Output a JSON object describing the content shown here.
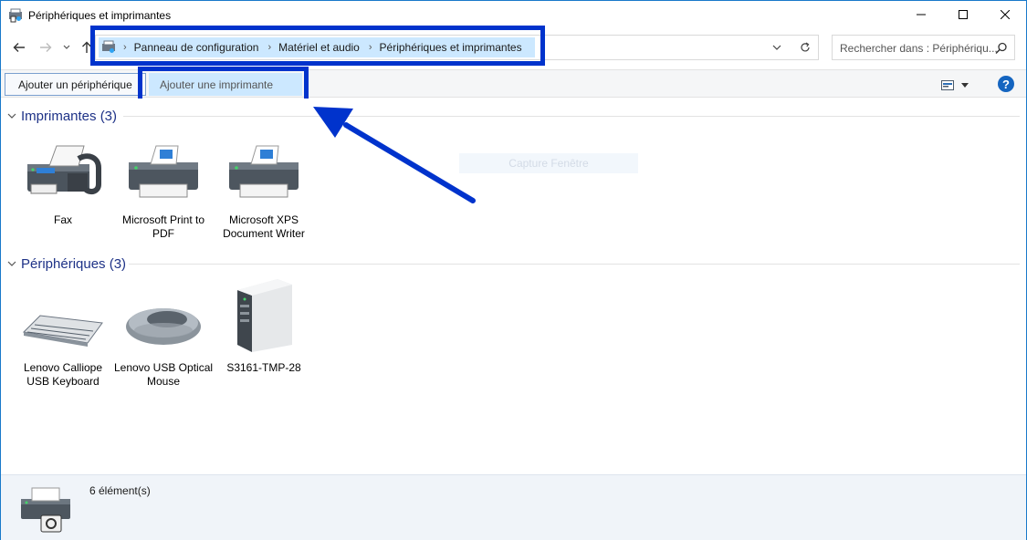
{
  "window": {
    "title": "Périphériques et imprimantes"
  },
  "breadcrumb": {
    "items": [
      "Panneau de configuration",
      "Matériel et audio",
      "Périphériques et imprimantes"
    ]
  },
  "search": {
    "placeholder": "Rechercher dans : Périphériqu..."
  },
  "toolbar": {
    "add_device_label": "Ajouter un périphérique",
    "add_printer_label": "Ajouter une imprimante",
    "help_label": "?"
  },
  "groups": {
    "printers": {
      "title": "Imprimantes (3)",
      "items": [
        {
          "label": "Fax",
          "icon": "fax-icon"
        },
        {
          "label": "Microsoft Print to PDF",
          "icon": "printer-icon"
        },
        {
          "label": "Microsoft XPS Document Writer",
          "icon": "printer-icon"
        }
      ]
    },
    "devices": {
      "title": "Périphériques (3)",
      "items": [
        {
          "label": "Lenovo Calliope USB Keyboard",
          "icon": "keyboard-icon"
        },
        {
          "label": "Lenovo USB Optical Mouse",
          "icon": "mouse-icon"
        },
        {
          "label": "S3161-TMP-28",
          "icon": "computer-tower-icon"
        }
      ]
    }
  },
  "ghost_text": "Capture Fenêtre",
  "status": {
    "count": "6 élément(s)"
  },
  "colors": {
    "highlight": "#0033cc",
    "selection": "#cce8ff",
    "group_title": "#1e3287"
  }
}
